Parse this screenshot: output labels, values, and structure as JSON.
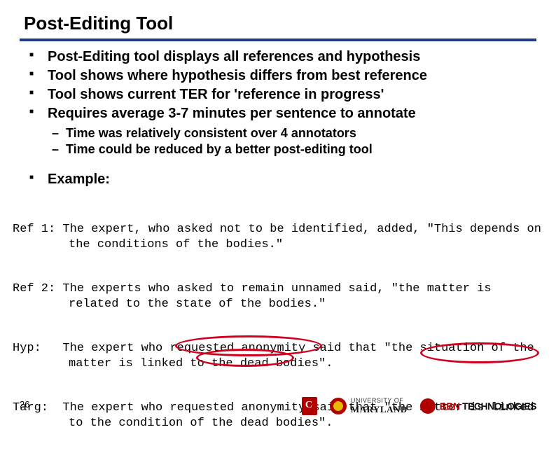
{
  "title": "Post-Editing Tool",
  "bullets": [
    "Post-Editing tool displays all references and hypothesis",
    "Tool shows where hypothesis differs from best reference",
    "Tool shows current TER for 'reference in progress'",
    "Requires average 3-7 minutes per sentence to annotate"
  ],
  "sub_bullets": [
    "Time was relatively consistent over 4 annotators",
    "Time could be reduced by a better post-editing tool"
  ],
  "example_label": "Example:",
  "mono": {
    "ref1_label": "Ref 1:",
    "ref1_text": "The expert, who asked not to be identified, added, \"This depends on the conditions of the bodies.\"",
    "ref2_label": "Ref 2:",
    "ref2_text": "The experts who asked to remain unnamed said, \"the matter is related to the state of the bodies.\"",
    "hyp_label": "Hyp:",
    "hyp_text": "The expert who requested anonymity said that \"the situation of the matter is linked to the dead bodies\".",
    "targ_label": "Targ:",
    "targ_text": "The expert who requested anonymity said that \"the matter is linked to the condition of the dead bodies\"."
  },
  "page_number": "26",
  "logos": {
    "umd_label": "UNIVERSITY OF",
    "umd_name": "MARYLAND",
    "bbn_prefix": "BBN",
    "bbn_text": " TECHNOLOGIES"
  }
}
